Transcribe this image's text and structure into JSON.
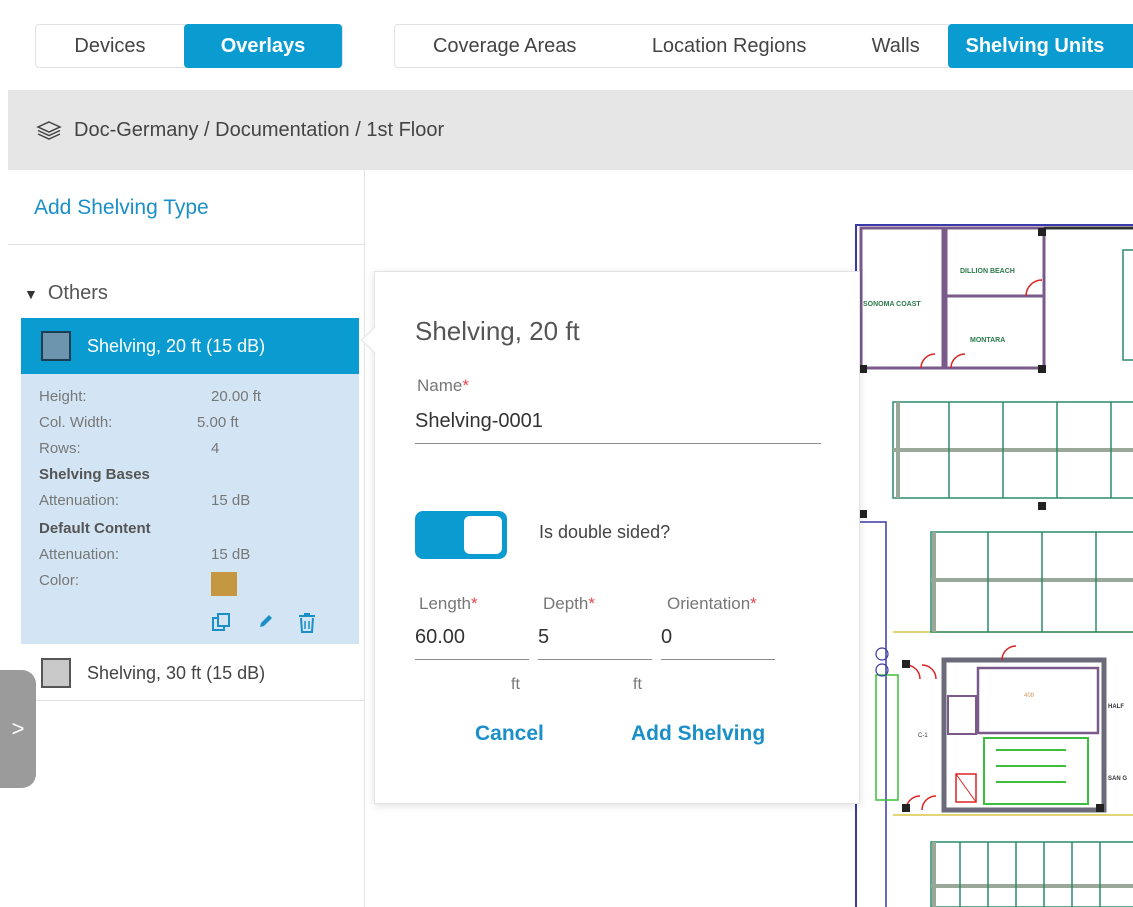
{
  "top_tabs": {
    "group1": [
      {
        "label": "Devices",
        "active": false
      },
      {
        "label": "Overlays",
        "active": true
      }
    ],
    "group2": [
      {
        "label": "Coverage Areas",
        "active": false
      },
      {
        "label": "Location Regions",
        "active": false
      },
      {
        "label": "Walls",
        "active": false
      },
      {
        "label": "Shelving Units",
        "active": true
      }
    ]
  },
  "breadcrumb": {
    "icon": "layers-icon",
    "path": "Doc-Germany / Documentation / 1st Floor"
  },
  "sidebar": {
    "add_link": "Add Shelving Type",
    "group": "Others",
    "items": [
      {
        "label": "Shelving, 20 ft (15 dB)",
        "color": "#6d95ad",
        "selected": true,
        "details": {
          "height_label": "Height:",
          "height_value": "20.00 ft",
          "colwidth_label": "Col. Width:",
          "colwidth_value": "5.00 ft",
          "rows_label": "Rows:",
          "rows_value": "4",
          "bases_heading": "Shelving Bases",
          "bases_att_label": "Attenuation:",
          "bases_att_value": "15 dB",
          "content_heading": "Default Content",
          "content_att_label": "Attenuation:",
          "content_att_value": "15 dB",
          "color_label": "Color:",
          "color_value": "#c69741"
        },
        "actions": [
          "copy-icon",
          "edit-icon",
          "delete-icon"
        ]
      },
      {
        "label": "Shelving, 30 ft (15 dB)",
        "color": "#c9c9c9",
        "selected": false
      }
    ],
    "expand_handle": ">"
  },
  "popover": {
    "title": "Shelving, 20 ft",
    "name_label": "Name",
    "name_value": "Shelving-0001",
    "toggle_label": "Is double sided?",
    "toggle_on": true,
    "length_label": "Length",
    "length_value": "60.00",
    "length_unit": "ft",
    "depth_label": "Depth",
    "depth_value": "5",
    "depth_unit": "ft",
    "orientation_label": "Orientation",
    "orientation_value": "0",
    "required_mark": "*",
    "cancel_label": "Cancel",
    "submit_label": "Add Shelving"
  },
  "map": {
    "rooms": [
      "DILLION BEACH",
      "SONOMA COAST",
      "MONTARA",
      "408",
      "C-1",
      "HALF",
      "SAN G"
    ]
  },
  "colors": {
    "accent": "#0a9bd1",
    "link": "#1a8fc8",
    "selected_details_bg": "#d3e5f4",
    "required": "#e5484d"
  }
}
